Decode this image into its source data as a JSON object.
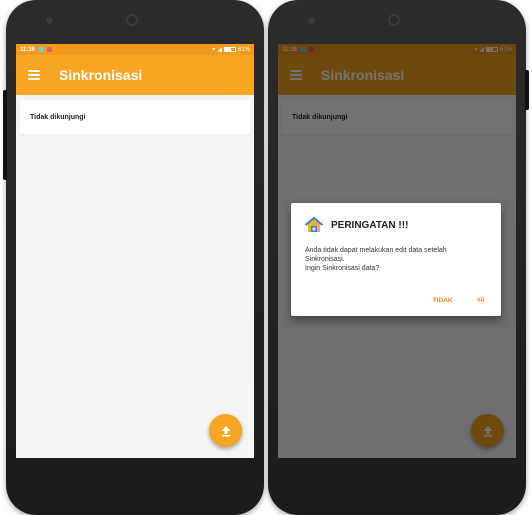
{
  "status_bar": {
    "time": "11:36",
    "battery": "61%"
  },
  "app_bar": {
    "title": "Sinkronisasi"
  },
  "list": {
    "items": [
      "Tidak dikunjungi"
    ]
  },
  "fab": {
    "icon": "upload-icon"
  },
  "dialog": {
    "title": "PERINGATAN !!!",
    "icon": "house-warning-icon",
    "message": "Anda tidak dapat melakukan edit data setelah\nSinkronisasi.\nIngin Sinkronisasi data?",
    "cancel_label": "TIDAK",
    "confirm_label": "YA"
  },
  "colors": {
    "primary": "#f7a523",
    "status_bar": "#f09a1e",
    "dialog_button": "#f08a1a",
    "background": "#f5f5f5"
  }
}
